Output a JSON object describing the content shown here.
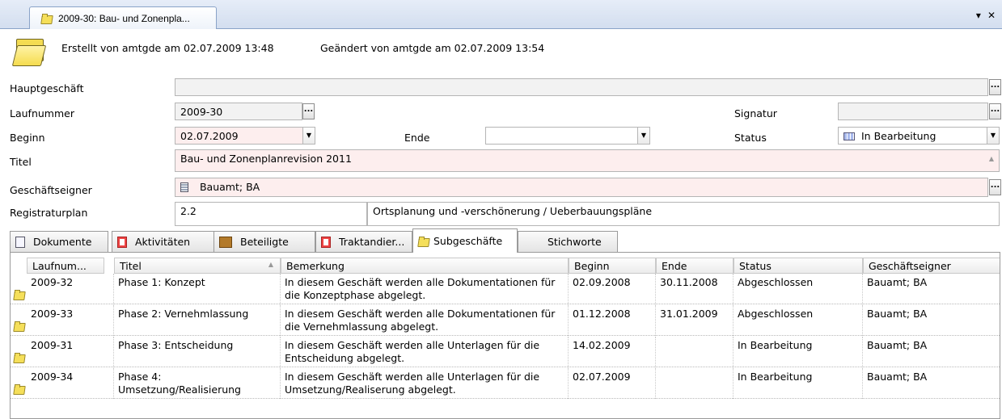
{
  "window": {
    "tab_title": "2009-30: Bau- und Zonenpla...",
    "menu_glyph": "▾",
    "close_glyph": "✕"
  },
  "meta": {
    "created": "Erstellt von amtgde am 02.07.2009 13:48",
    "changed": "Geändert von amtgde am 02.07.2009 13:54"
  },
  "form": {
    "hauptgeschaeft_label": "Hauptgeschäft",
    "hauptgeschaeft_value": "",
    "laufnummer_label": "Laufnummer",
    "laufnummer_value": "2009-30",
    "signatur_label": "Signatur",
    "signatur_value": "",
    "beginn_label": "Beginn",
    "beginn_value": "02.07.2009",
    "ende_label": "Ende",
    "ende_value": "",
    "status_label": "Status",
    "status_value": "In Bearbeitung",
    "titel_label": "Titel",
    "titel_value": "Bau- und Zonenplanrevision 2011",
    "eigner_label": "Geschäftseigner",
    "eigner_value": "Bauamt; BA",
    "registratur_label": "Registraturplan",
    "registratur_code": "2.2",
    "registratur_text": "Ortsplanung und -verschönerung / Ueberbauungspläne",
    "dots": "..."
  },
  "tabs": [
    {
      "label": "Dokumente"
    },
    {
      "label": "Aktivitäten"
    },
    {
      "label": "Beteiligte"
    },
    {
      "label": "Traktandier..."
    },
    {
      "label": "Subgeschäfte"
    },
    {
      "label": "Stichworte"
    }
  ],
  "grid": {
    "columns": [
      "Laufnum...",
      "Titel",
      "Bemerkung",
      "Beginn",
      "Ende",
      "Status",
      "Geschäftseigner"
    ],
    "sort_glyph": "▲",
    "rows": [
      {
        "laufnummer": "2009-32",
        "titel": "Phase 1: Konzept",
        "bemerkung": "In diesem Geschäft werden alle Dokumentationen für die Konzeptphase abgelegt.",
        "beginn": "02.09.2008",
        "ende": "30.11.2008",
        "status": "Abgeschlossen",
        "eigner": "Bauamt; BA"
      },
      {
        "laufnummer": "2009-33",
        "titel": "Phase 2: Vernehmlassung",
        "bemerkung": "In diesem Geschäft werden alle Dokumentationen für die Vernehmlassung abgelegt.",
        "beginn": "01.12.2008",
        "ende": "31.01.2009",
        "status": "Abgeschlossen",
        "eigner": "Bauamt; BA"
      },
      {
        "laufnummer": "2009-31",
        "titel": "Phase 3: Entscheidung",
        "bemerkung": "In diesem Geschäft werden alle Unterlagen für die Entscheidung abgelegt.",
        "beginn": "14.02.2009",
        "ende": "",
        "status": "In Bearbeitung",
        "eigner": "Bauamt; BA"
      },
      {
        "laufnummer": "2009-34",
        "titel": "Phase 4: Umsetzung/Realisierung",
        "bemerkung": "In diesem Geschäft werden alle Unterlagen für die Umsetzung/Realiserung abgelegt.",
        "beginn": "02.07.2009",
        "ende": "",
        "status": "In Bearbeitung",
        "eigner": "Bauamt; BA"
      }
    ]
  }
}
